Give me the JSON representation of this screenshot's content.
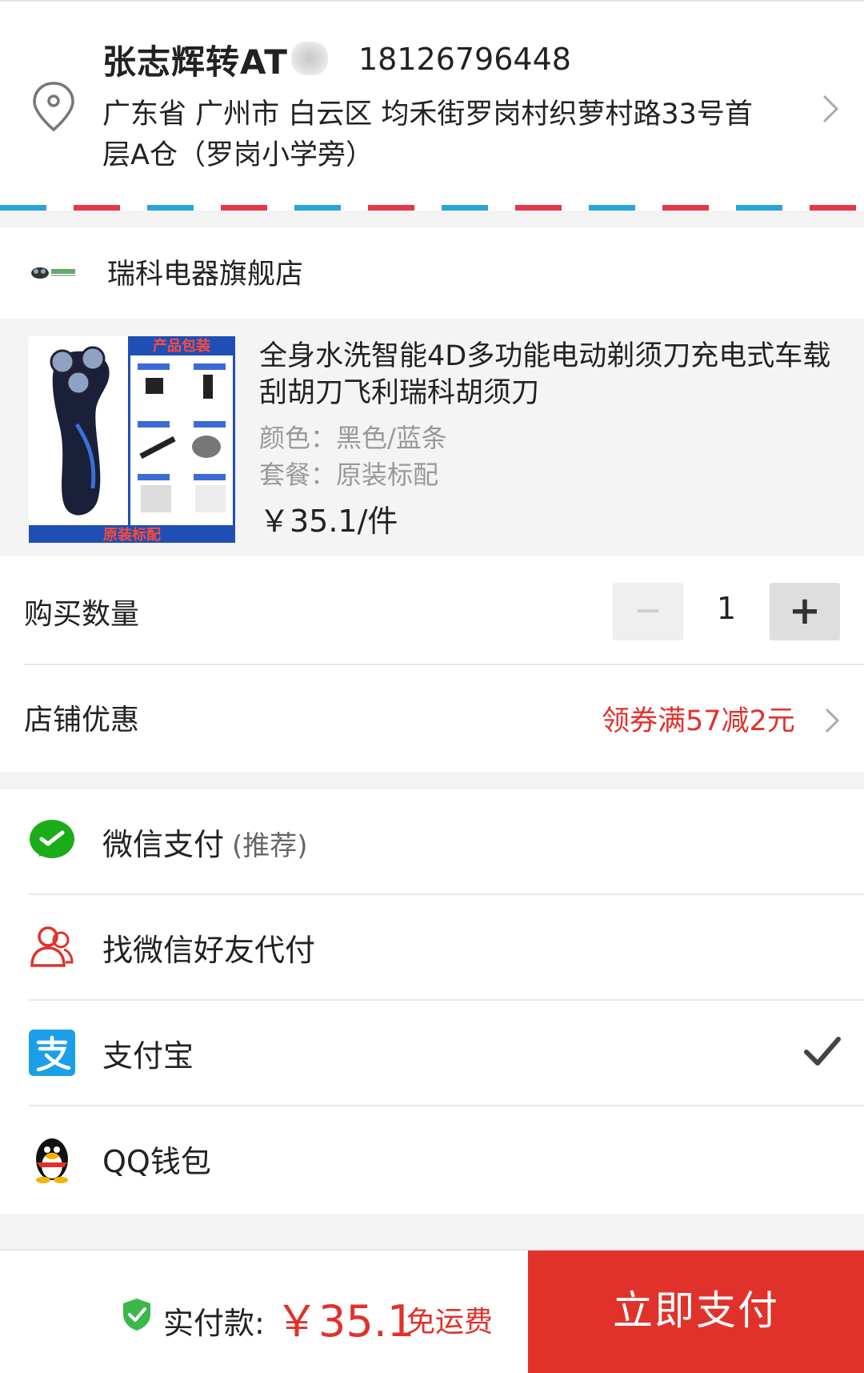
{
  "address": {
    "name": "张志辉转AT",
    "phone": "18126796448",
    "full_address": "广东省 广州市 白云区 均禾街罗岗村织萝村路33号首层A仓（罗岗小学旁）",
    "icons": {
      "location": "location-pin-icon",
      "chevron": "chevron-right-icon"
    }
  },
  "store": {
    "name": "瑞科电器旗舰店",
    "logo_icon": "store-logo-icon"
  },
  "product": {
    "title": "全身水洗智能4D多功能电动剃须刀充电式车载刮胡刀飞利瑞科胡须刀",
    "color": "颜色：黑色/蓝条",
    "package": "套餐：原装标配",
    "price": "￥35.1/件",
    "image_text": {
      "top": "产品包装",
      "bottom": "原装标配"
    }
  },
  "quantity": {
    "label": "购买数量",
    "minus": "−",
    "value": "1",
    "plus": "+"
  },
  "coupon": {
    "label": "店铺优惠",
    "value": "领券满57减2元"
  },
  "payments": [
    {
      "label": "微信支付",
      "sub": "(推荐)",
      "icon": "wechat-pay-icon",
      "selected": false
    },
    {
      "label": "找微信好友代付",
      "sub": "",
      "icon": "friend-pay-icon",
      "selected": false
    },
    {
      "label": "支付宝",
      "sub": "",
      "icon": "alipay-icon",
      "selected": true
    },
    {
      "label": "QQ钱包",
      "sub": "",
      "icon": "qq-wallet-icon",
      "selected": false
    }
  ],
  "footer": {
    "pay_label": "实付款:",
    "amount": "￥35.1",
    "shipping": "免运费",
    "pay_button": "立即支付",
    "colors": {
      "accent": "#e0322b"
    }
  }
}
